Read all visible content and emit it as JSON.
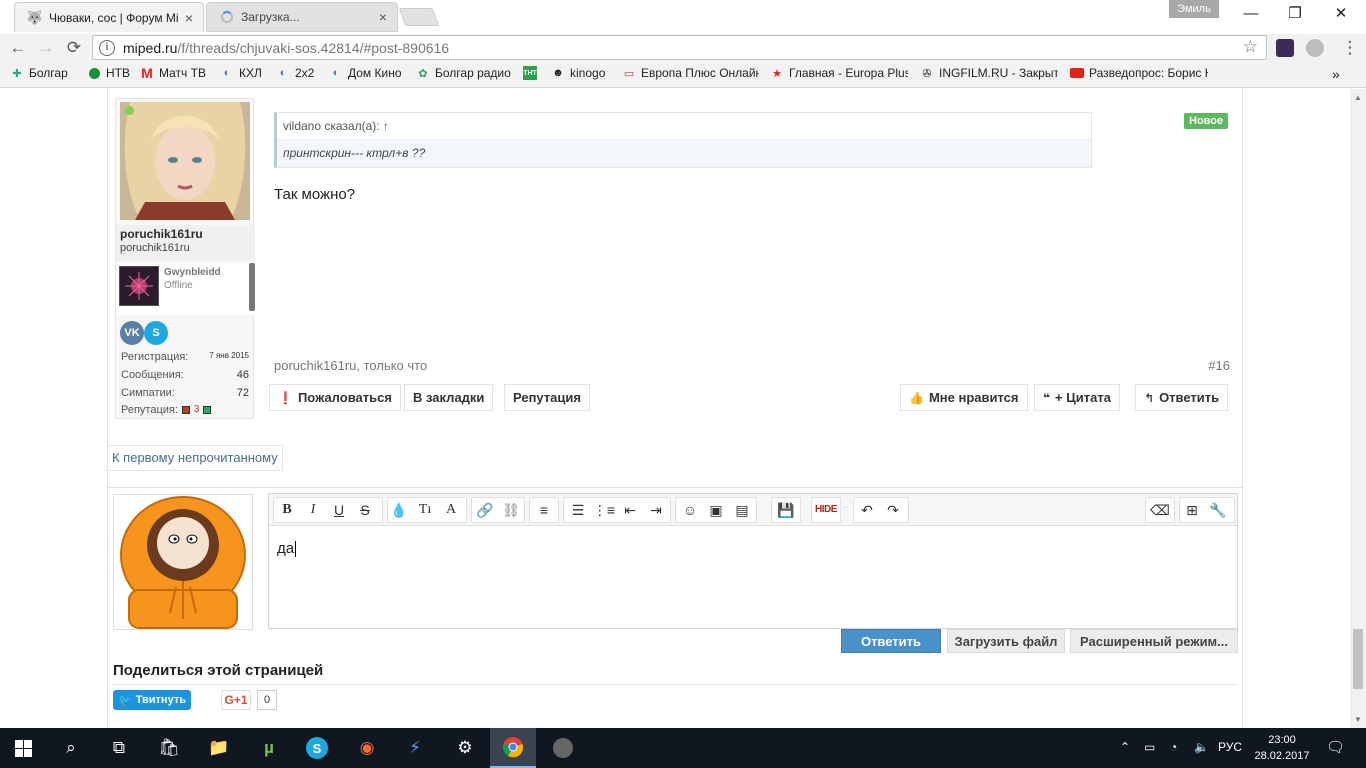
{
  "browser": {
    "tabs": [
      {
        "title": "Чюваки, сос | Форум Mi",
        "close": "×",
        "icon": "wolf-icon"
      },
      {
        "title": "Загрузка...",
        "close": "×",
        "icon": "loading-icon"
      }
    ],
    "profile_name": "Эмиль",
    "window_controls": {
      "minimize": "—",
      "maximize": "❐",
      "close": "✕"
    },
    "nav": {
      "back": "←",
      "forward": "→",
      "reload": "⟳",
      "menu": "⋮"
    },
    "url_host": "miped.ru",
    "url_path": "/f/threads/chjuvaki-sos.42814/#post-890616",
    "bookmarks": [
      {
        "label": "Болгар",
        "icon": "bolgar-icon"
      },
      {
        "label": "НТВ",
        "icon": "ntv-icon"
      },
      {
        "label": "Матч ТВ",
        "icon": "match-tv-icon"
      },
      {
        "label": "КХЛ",
        "icon": "globe-icon"
      },
      {
        "label": "2х2",
        "icon": "globe-icon"
      },
      {
        "label": "Дом Кино",
        "icon": "globe-icon"
      },
      {
        "label": "Болгар радио",
        "icon": "radio-icon"
      },
      {
        "label": "ТНТ",
        "icon": "tnt-icon"
      },
      {
        "label": "kinogo",
        "icon": "kinogo-icon"
      },
      {
        "label": "Европа Плюс Онлайн",
        "icon": "europa-plus-icon"
      },
      {
        "label": "Главная - Europa Plus",
        "icon": "europa-star-icon"
      },
      {
        "label": "INGFILM.RU - Закрыт",
        "icon": "film-icon"
      },
      {
        "label": "Разведопрос: Борис Ю",
        "icon": "youtube-icon"
      }
    ],
    "more_bookmarks": "»"
  },
  "post": {
    "username": "poruchik161ru",
    "user_title": "poruchik161ru",
    "linked_name": "Gwynbleidd",
    "linked_status": "Offline",
    "social": [
      {
        "label": "VK",
        "color": "#5b7fa6"
      },
      {
        "label": "S",
        "color": "#1ea7e0"
      }
    ],
    "stats": [
      {
        "label": "Регистрация:",
        "value": "7 янв 2015"
      },
      {
        "label": "Сообщения:",
        "value": "46"
      },
      {
        "label": "Симпатии:",
        "value": "72"
      },
      {
        "label": "Репутация:",
        "value": "3"
      }
    ],
    "quote_author": "vildano сказал(а): ↑",
    "quote_text": "принтскрин--- ктрл+в ??",
    "badge": "Новое",
    "message": "Так можно?",
    "meta_author": "poruchik161ru",
    "meta_time": ", только что",
    "number": "#16",
    "actions_left": [
      {
        "label": "Пожаловаться",
        "icon": "alert-icon",
        "glyph": "❗"
      },
      {
        "label": "В закладки"
      },
      {
        "label": "Репутация"
      }
    ],
    "actions_right": [
      {
        "label": "Мне нравится",
        "icon": "thumbs-up-icon",
        "glyph": "👍"
      },
      {
        "label": "+ Цитата",
        "icon": "quote-icon",
        "glyph": "❝"
      },
      {
        "label": "Ответить",
        "icon": "reply-icon",
        "glyph": "↰"
      }
    ]
  },
  "unread_link": "К первому непрочитанному",
  "editor": {
    "text": "да",
    "toolbar": {
      "bold": "B",
      "italic": "I",
      "underline": "U",
      "strike": "S",
      "hide": "HIDE"
    }
  },
  "reply_buttons": {
    "submit": "Ответить",
    "upload": "Загрузить файл",
    "advanced": "Расширенный режим..."
  },
  "share": {
    "title": "Поделиться этой страницей",
    "tweet": "Твитнуть",
    "gplus": "G+1",
    "gcount": "0"
  },
  "taskbar": {
    "lang": "РУС",
    "time": "23:00",
    "date": "28.02.2017"
  }
}
